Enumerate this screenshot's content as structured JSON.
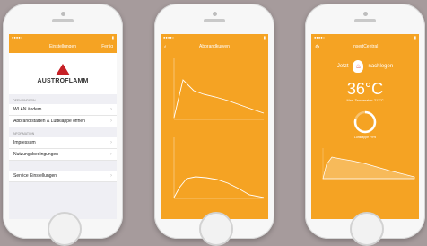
{
  "screen1": {
    "title": "Einstellungen",
    "right_action": "Fertig",
    "brand": "AUSTROFLAMM",
    "sections": [
      {
        "header": "OFEN ÄNDERN",
        "items": [
          "WLAN ändern",
          "Abbrand starten & Luftklappe öffnen"
        ]
      },
      {
        "header": "INFORMATION",
        "items": [
          "Impressum",
          "Nutzungsbedingungen"
        ]
      },
      {
        "header": "",
        "items": [
          "Service Einstellungen"
        ]
      }
    ]
  },
  "screen2": {
    "title": "Abbrandkurven",
    "back_icon": "chevron-left-icon"
  },
  "screen3": {
    "title": "InsertCentral",
    "toggle_left": "Jetzt",
    "toggle_right": "nachlegen",
    "temperature": "36°C",
    "max_temp": "Max. Temperatur: 212°C",
    "ring_label": "Luftklappe 79%",
    "ring_fraction": 0.79,
    "accent": "#f5a323"
  }
}
